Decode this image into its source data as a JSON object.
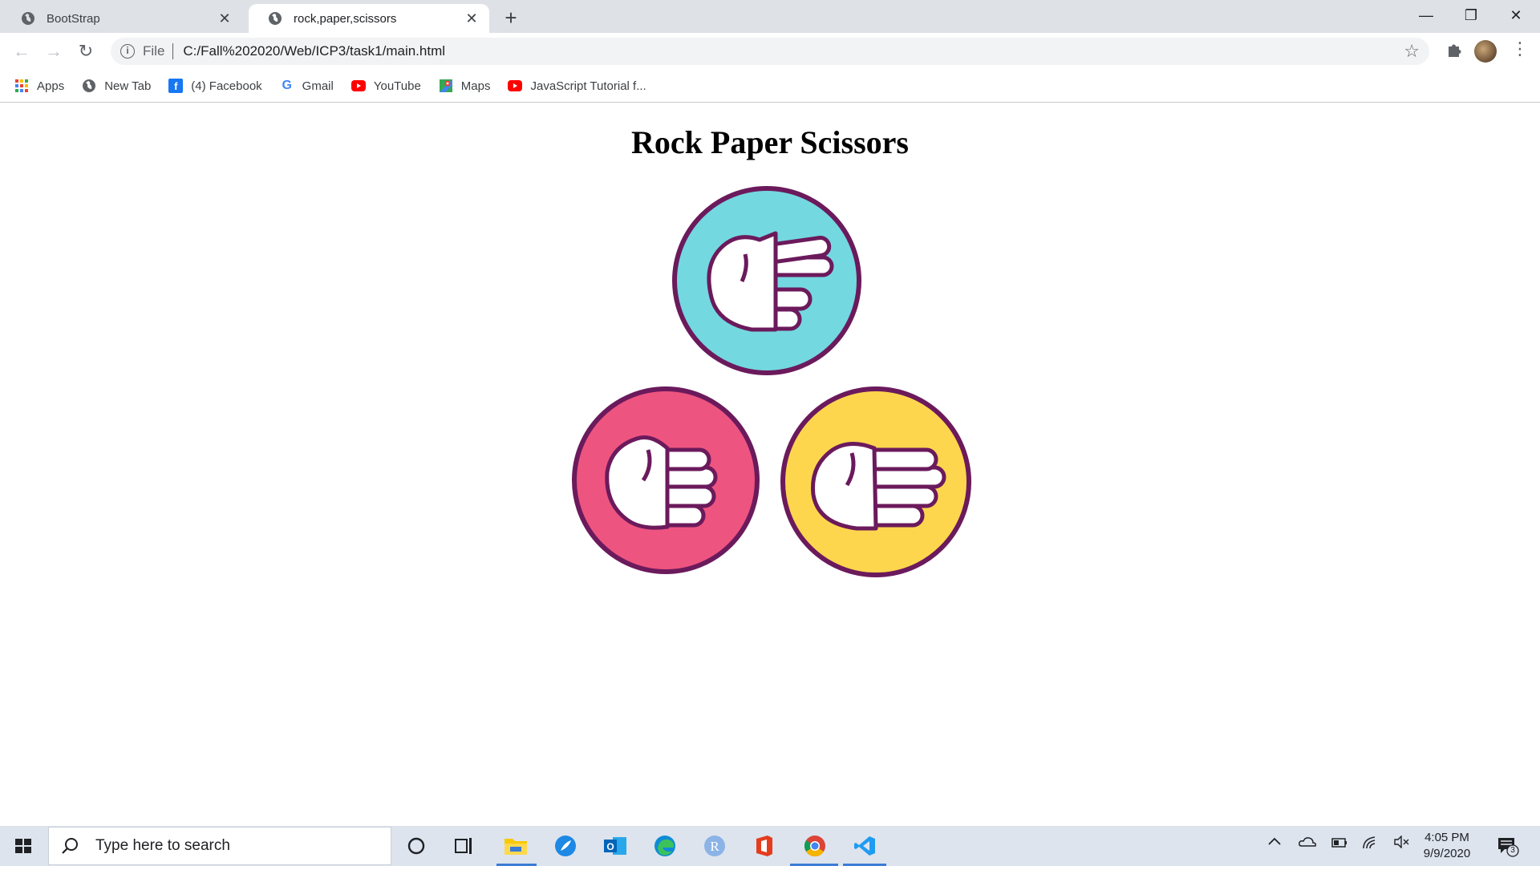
{
  "browser": {
    "tabs": [
      {
        "title": "BootStrap",
        "active": false
      },
      {
        "title": "rock,paper,scissors",
        "active": true
      }
    ],
    "address": {
      "scheme": "File",
      "url": "C:/Fall%202020/Web/ICP3/task1/main.html"
    },
    "bookmarks": [
      {
        "label": "Apps",
        "icon": "apps-grid-icon"
      },
      {
        "label": "New Tab",
        "icon": "globe-icon"
      },
      {
        "label": "(4) Facebook",
        "icon": "facebook-icon"
      },
      {
        "label": "Gmail",
        "icon": "google-icon"
      },
      {
        "label": "YouTube",
        "icon": "youtube-icon"
      },
      {
        "label": "Maps",
        "icon": "maps-icon"
      },
      {
        "label": "JavaScript Tutorial f...",
        "icon": "youtube-icon"
      }
    ]
  },
  "page": {
    "title": "Rock Paper Scissors",
    "gestures": [
      {
        "name": "scissors",
        "color": "#74d8e0"
      },
      {
        "name": "rock",
        "color": "#ee5480"
      },
      {
        "name": "paper",
        "color": "#fed64e"
      }
    ],
    "outline_color": "#6b1a5c"
  },
  "taskbar": {
    "search_placeholder": "Type here to search",
    "time": "4:05 PM",
    "date": "9/9/2020",
    "notification_count": "3"
  }
}
